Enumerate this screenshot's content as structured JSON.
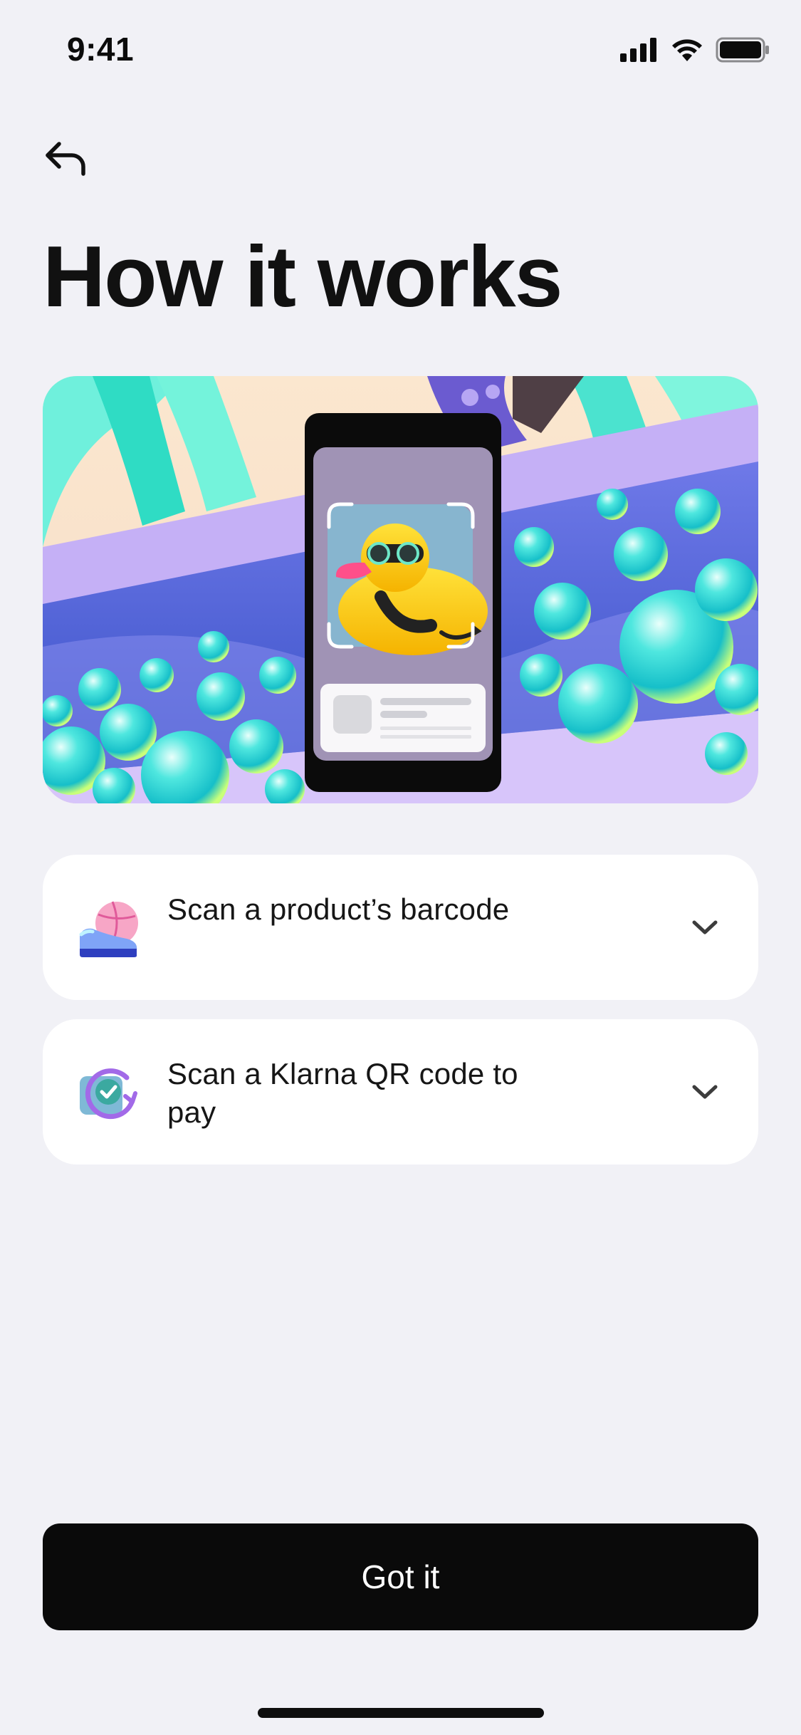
{
  "status_bar": {
    "time": "9:41",
    "icons": [
      "cellular-signal-icon",
      "wifi-icon",
      "battery-icon"
    ]
  },
  "nav": {
    "back_icon": "back-arrow-icon"
  },
  "title": "How it works",
  "hero": {
    "description_icon": "scanning-illustration"
  },
  "steps": [
    {
      "label": "Scan a product’s barcode",
      "icon": "sneaker-ball-icon",
      "chevron": "chevron-down-icon"
    },
    {
      "label": "Scan a Klarna QR code to pay",
      "icon": "checkmark-cycle-icon",
      "chevron": "chevron-down-icon"
    }
  ],
  "primary_button": {
    "label": "Got it"
  },
  "colors": {
    "background": "#f1f1f6",
    "card": "#ffffff",
    "button": "#0a0a0a",
    "button_text": "#ffffff"
  }
}
